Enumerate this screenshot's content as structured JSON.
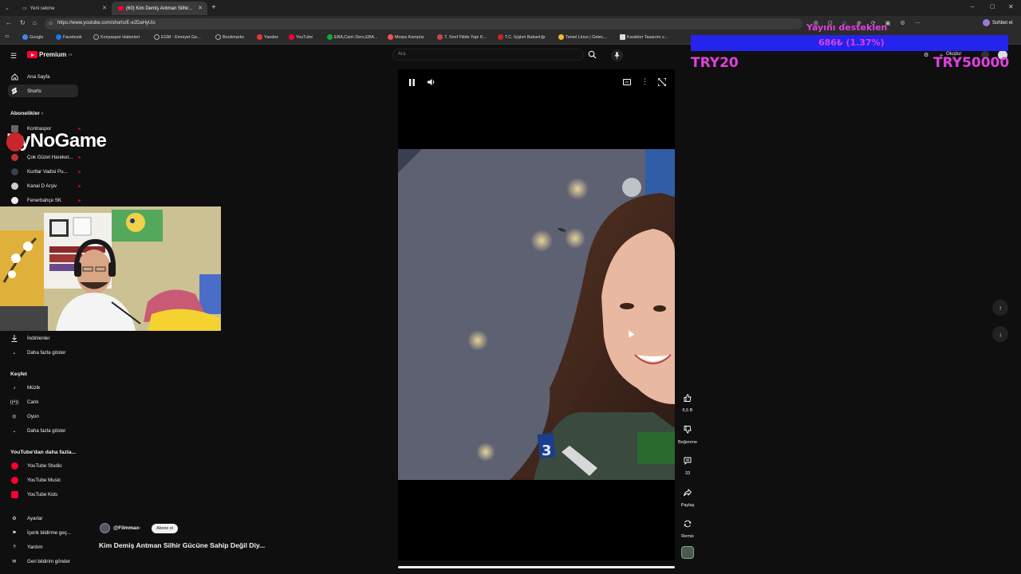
{
  "browser": {
    "tabs": [
      {
        "label": "Yeni sekme"
      },
      {
        "label": "(60) Kim Demiş Antman Silhir..."
      }
    ],
    "url": "https://www.youtube.com/shorts/E-e2DaHyUic",
    "bookmarks": [
      "Google",
      "Facebook",
      "Konyaspor Haberleri",
      "EGM - Emniyet Ge...",
      "Bookmarks",
      "Yandex",
      "YouTube",
      "EBA,Canlı Ders,EBA...",
      "Morpa Kampüs",
      "7. Sınıf Fiilde Yapı K...",
      "T.C. İçişleri Bakanlığı",
      "Temel Linux | Gelec...",
      "Karakter Tasarımı v..."
    ],
    "profile_label": "Sohbet et"
  },
  "youtube": {
    "logo_text": "Premium",
    "logo_sup": "TR",
    "search_placeholder": "Ara",
    "nav": [
      {
        "label": "Ana Sayfa",
        "icon": "home-icon"
      },
      {
        "label": "Shorts",
        "icon": "shorts-icon"
      }
    ],
    "subs_header": "Abonelikler",
    "subs": [
      "Kontraspor",
      "Çok Güzel Hareket...",
      "Kurtlar Vadisi Pu...",
      "Kanal D Arşiv",
      "Fenerbahçe SK"
    ],
    "you_items": [
      {
        "label": "İndirilenler"
      },
      {
        "label": "Daha fazla göster"
      }
    ],
    "explore_header": "Keşfet",
    "explore": [
      "Müzik",
      "Canlı",
      "Oyun",
      "Daha fazla göster"
    ],
    "more_header": "YouTube'dan daha fazla...",
    "more": [
      "YouTube Studio",
      "YouTube Music",
      "YouTube Kids"
    ],
    "footer": [
      "Ayarlar",
      "İçerik bildirme geç...",
      "Yardım",
      "Geri bildirim gönder"
    ],
    "create_label": "Oluştur"
  },
  "short": {
    "channel": "@Filmmax-",
    "subscribe": "Abone ol",
    "title": "Kim Demiş Antman Silhir Gücüne Sahip Değil Diy...",
    "likes": "6,5 B",
    "dislike": "Beğenme",
    "comments": "33",
    "share": "Paylaş",
    "remix": "Remix"
  },
  "stream": {
    "overlay_title": "ByNoGame",
    "donate_text": "Yayını desteklen",
    "donate_progress": "686₺ (1.37%)",
    "goal_left": "TRY20",
    "goal_right": "TRY50000"
  },
  "colors": {
    "yt_red": "#ff0033",
    "bg": "#0f0f0f",
    "donate_bar": "#2424ee",
    "overlay_pink": "#e040e0"
  }
}
